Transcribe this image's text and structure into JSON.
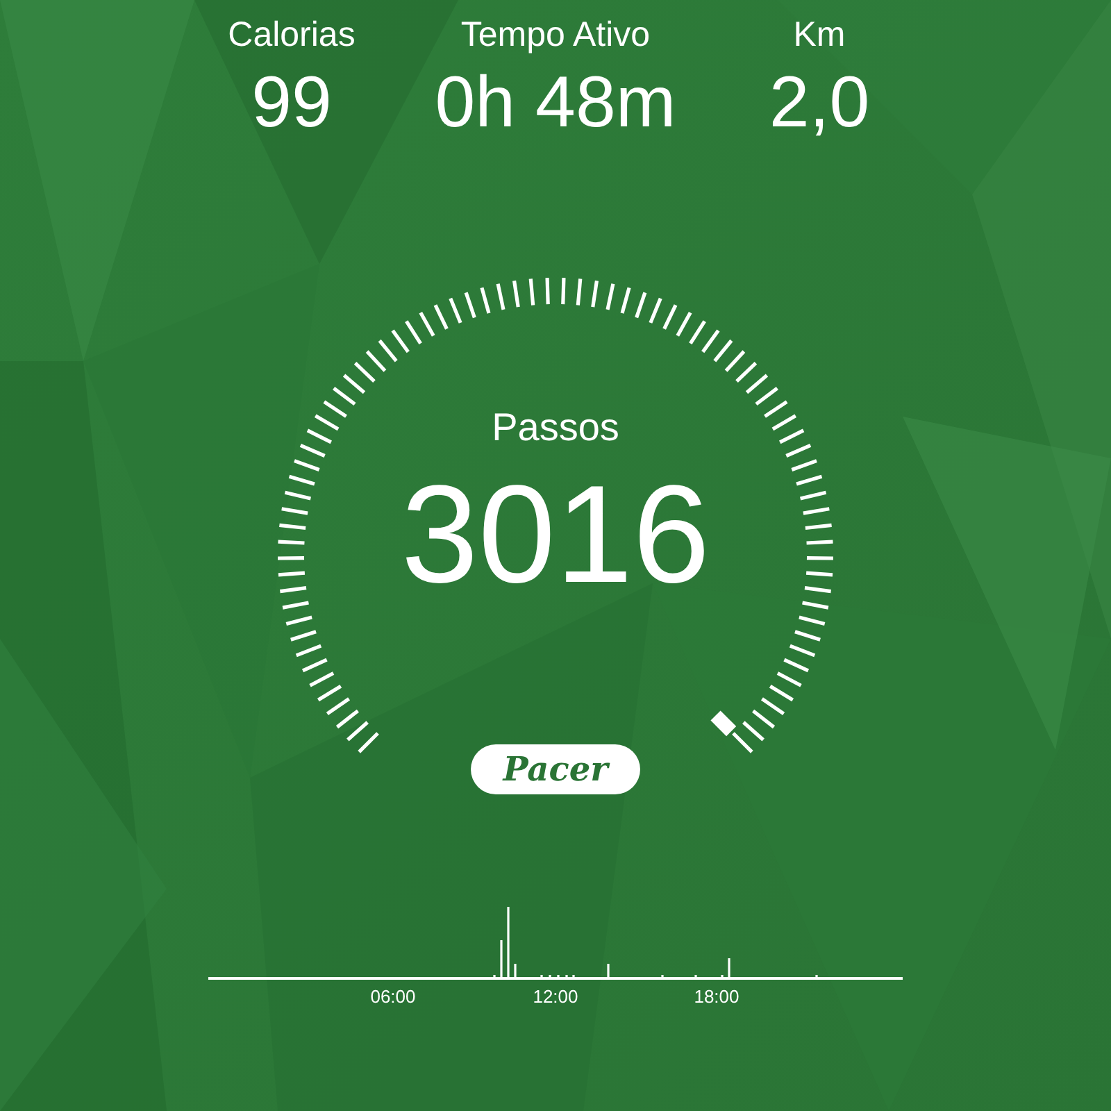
{
  "stats": [
    {
      "label": "Calorias",
      "value": "99"
    },
    {
      "label": "Tempo Ativo",
      "value": "0h 48m"
    },
    {
      "label": "Km",
      "value": "2,0"
    }
  ],
  "steps": {
    "label": "Passos",
    "value": "3016"
  },
  "logo": "Pacer",
  "timeline": {
    "labels": [
      "06:00",
      "12:00",
      "18:00"
    ]
  }
}
